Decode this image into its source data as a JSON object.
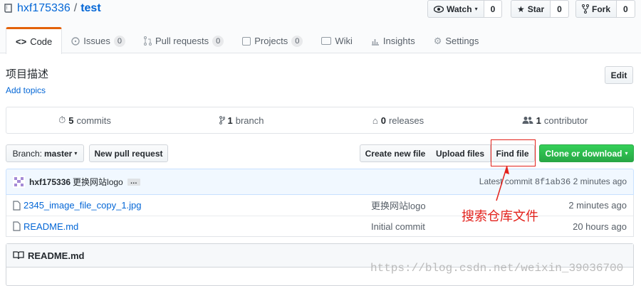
{
  "repo": {
    "owner": "hxf175336",
    "separator": "/",
    "name": "test"
  },
  "actions": {
    "watch": {
      "label": "Watch",
      "count": "0"
    },
    "star": {
      "label": "Star",
      "count": "0"
    },
    "fork": {
      "label": "Fork",
      "count": "0"
    }
  },
  "tabs": [
    {
      "label": "Code",
      "icon": "code-icon"
    },
    {
      "label": "Issues",
      "count": "0",
      "icon": "issue-icon"
    },
    {
      "label": "Pull requests",
      "count": "0",
      "icon": "pull-request-icon"
    },
    {
      "label": "Projects",
      "count": "0",
      "icon": "project-icon"
    },
    {
      "label": "Wiki",
      "icon": "book-icon"
    },
    {
      "label": "Insights",
      "icon": "graph-icon"
    },
    {
      "label": "Settings",
      "icon": "gear-icon"
    }
  ],
  "description": "项目描述",
  "add_topics": "Add topics",
  "edit_label": "Edit",
  "summary": {
    "commits_n": "5",
    "commits_label": "commits",
    "branch_n": "1",
    "branch_label": "branch",
    "releases_n": "0",
    "releases_label": "releases",
    "contrib_n": "1",
    "contrib_label": "contributor"
  },
  "toolbar": {
    "branch_label": "Branch:",
    "branch_value": "master",
    "new_pr": "New pull request",
    "create_file": "Create new file",
    "upload_files": "Upload files",
    "find_file": "Find file",
    "clone": "Clone or download"
  },
  "commit": {
    "author": "hxf175336",
    "message": "更换网站logo",
    "ellipsis": "…",
    "latest_label": "Latest commit",
    "sha": "8f1ab36",
    "age": "2 minutes ago"
  },
  "files": [
    {
      "name": "2345_image_file_copy_1.jpg",
      "message": "更换网站logo",
      "age": "2 minutes ago"
    },
    {
      "name": "README.md",
      "message": "Initial commit",
      "age": "20 hours ago"
    }
  ],
  "readme_title": "README.md",
  "annotation": "搜索仓库文件",
  "watermark": "https://blog.csdn.net/weixin_39036700",
  "colors": {
    "accent": "#e36209",
    "link": "#0366d6",
    "green": "#28a745",
    "annotation": "#e3211b"
  }
}
